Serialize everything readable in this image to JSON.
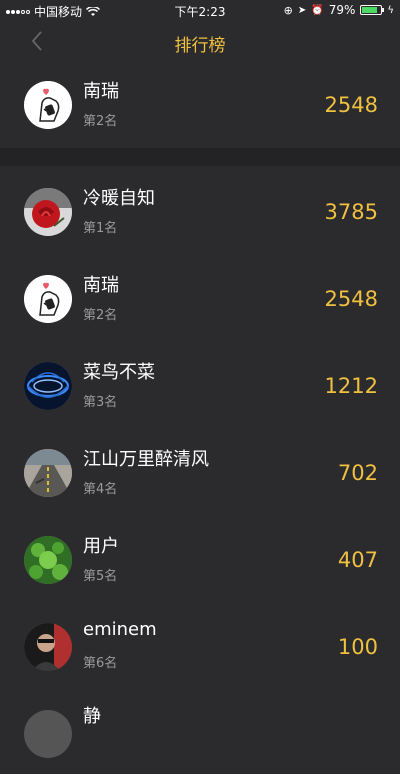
{
  "status": {
    "carrier": "中国移动",
    "time": "下午2:23",
    "battery": "79%",
    "battery_level": 0.79
  },
  "nav": {
    "title": "排行榜"
  },
  "my_rank": {
    "name": "南瑞",
    "rank": "第2名",
    "score": "2548",
    "avatar": "cat-sticker"
  },
  "list": [
    {
      "name": "冷暖自知",
      "rank": "第1名",
      "score": "3785",
      "avatar": "red-rose"
    },
    {
      "name": "南瑞",
      "rank": "第2名",
      "score": "2548",
      "avatar": "cat-sticker"
    },
    {
      "name": "菜鸟不菜",
      "rank": "第3名",
      "score": "1212",
      "avatar": "blue-light"
    },
    {
      "name": "江山万里醉清风",
      "rank": "第4名",
      "score": "702",
      "avatar": "road"
    },
    {
      "name": "用户",
      "rank": "第5名",
      "score": "407",
      "avatar": "clover"
    },
    {
      "name": "eminem",
      "rank": "第6名",
      "score": "100",
      "avatar": "portrait"
    },
    {
      "name": "静",
      "rank": "",
      "score": "",
      "avatar": "unknown"
    }
  ]
}
